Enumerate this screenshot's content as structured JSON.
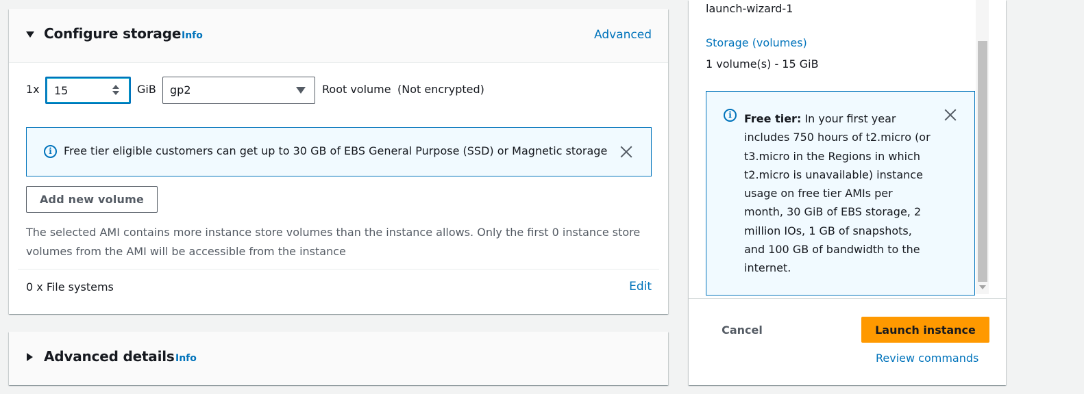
{
  "storage": {
    "title": "Configure storage",
    "info": "Info",
    "advanced_link": "Advanced",
    "count_prefix": "1x",
    "size_value": "15",
    "size_unit": "GiB",
    "volume_type": "gp2",
    "root_label": "Root volume",
    "encryption": "(Not encrypted)",
    "free_tier_alert": "Free tier eligible customers can get up to 30 GB of EBS General Purpose (SSD) or Magnetic storage",
    "add_volume_button": "Add new volume",
    "ami_note": "The selected AMI contains more instance store volumes than the instance allows. Only the first 0 instance store volumes from the AMI will be accessible from the instance",
    "file_systems": "0 x File systems",
    "edit_link": "Edit"
  },
  "advanced_details": {
    "title": "Advanced details",
    "info": "Info"
  },
  "summary": {
    "security_group_value": "launch-wizard-1",
    "storage_link": "Storage (volumes)",
    "storage_value": "1 volume(s) - 15 GiB",
    "free_tier_title": "Free tier:",
    "free_tier_text": "In your first year includes 750 hours of t2.micro (or t3.micro in the Regions in which t2.micro is unavailable) instance usage on free tier AMIs per month, 30 GiB of EBS storage, 2 million IOs, 1 GB of snapshots, and 100 GB of bandwidth to the internet.",
    "cancel_button": "Cancel",
    "launch_button": "Launch instance",
    "review_link": "Review commands"
  },
  "colors": {
    "link": "#0073bb",
    "primary_button": "#ff9900",
    "info_background": "#f1faff"
  },
  "icons": [
    "caret-down-icon",
    "caret-right-icon",
    "info-circle-icon",
    "close-icon",
    "dropdown-arrow-icon",
    "spinner-icon"
  ]
}
